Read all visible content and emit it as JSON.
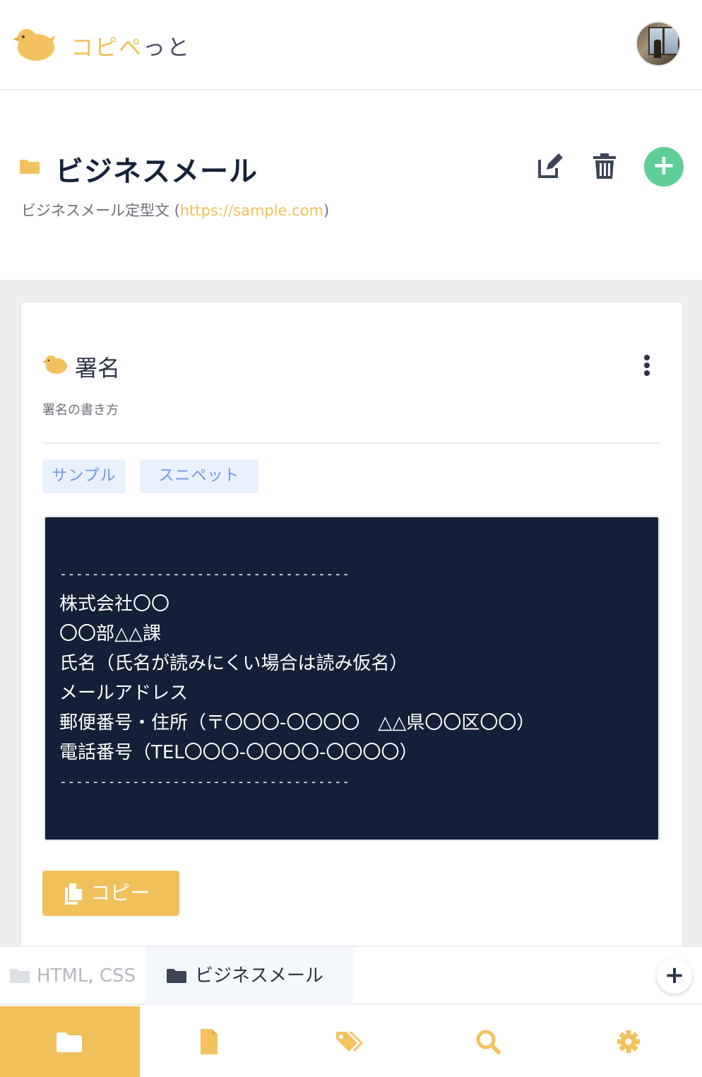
{
  "header": {
    "brand_main": "コピペ",
    "brand_accent": "っと"
  },
  "folder": {
    "title": "ビジネスメール",
    "description_text": "ビジネスメール定型文 (",
    "description_link": "https://sample.com",
    "description_end": ")"
  },
  "snippet": {
    "title": "署名",
    "description": "署名の書き方",
    "tags": [
      "サンプル",
      "スニペット"
    ],
    "code_lines": [
      "------------------------------------",
      "株式会社〇〇",
      "〇〇部△△課",
      "氏名（氏名が読みにくい場合は読み仮名）",
      "メールアドレス",
      "郵便番号・住所（〒〇〇〇-〇〇〇〇　△△県〇〇区〇〇）",
      "電話番号（TEL〇〇〇-〇〇〇〇-〇〇〇〇）",
      "------------------------------------"
    ],
    "copy_label": "コピー"
  },
  "folder_tabs": [
    {
      "label": "HTML, CSS"
    },
    {
      "label": "ビジネスメール"
    }
  ],
  "bottom_nav": {
    "items": [
      "folder-icon",
      "file-icon",
      "tags-icon",
      "search-icon",
      "gear-icon"
    ],
    "active_index": 0
  },
  "colors": {
    "brand": "#f0c05a",
    "accent_green": "#5fce97",
    "code_bg": "#132037",
    "tag_text": "#6f96ea",
    "tag_bg": "#e9f1fd"
  }
}
